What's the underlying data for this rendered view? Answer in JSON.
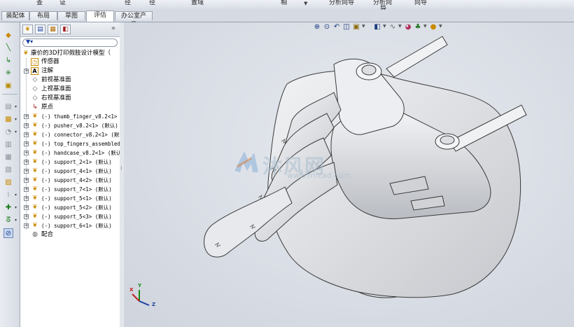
{
  "command_strip": {
    "labels": [
      "查",
      "证",
      "径",
      "径",
      "置域",
      "相",
      "分析向导",
      "分析向",
      "导",
      "向导"
    ]
  },
  "tabs": [
    {
      "label": "装配体",
      "active": false
    },
    {
      "label": "布局",
      "active": false
    },
    {
      "label": "草图",
      "active": false
    },
    {
      "label": "评估",
      "active": true
    },
    {
      "label": "办公室产品",
      "active": false
    }
  ],
  "feature_tree": {
    "filter_glyph": "▼▾",
    "more_glyph": "»",
    "root_label": "康价的3D打印假肢设计模型（",
    "items": [
      {
        "label": "传感器"
      },
      {
        "label": "注解"
      },
      {
        "label": "前视基准面"
      },
      {
        "label": "上视基准面"
      },
      {
        "label": "右视基准面"
      },
      {
        "label": "原点"
      },
      {
        "label": "(-) thumb_finger_v8.2<1>"
      },
      {
        "label": "(-) pusher_v8.2<1> (默认)"
      },
      {
        "label": "(-) connector_v8.2<1> (默认"
      },
      {
        "label": "(-) top_fingers_assembled"
      },
      {
        "label": "(-) handcase_v8.2<1> (默认"
      },
      {
        "label": "(-) support_2<1> (默认)"
      },
      {
        "label": "(-) support_4<1> (默认)"
      },
      {
        "label": "(-) support_4<2> (默认)"
      },
      {
        "label": "(-) support_7<1> (默认)"
      },
      {
        "label": "(-) support_5<1> (默认)"
      },
      {
        "label": "(-) support_5<2> (默认)"
      },
      {
        "label": "(-) support_5<3> (默认)"
      },
      {
        "label": "(-) support_6<1> (默认)"
      },
      {
        "label": "配合"
      }
    ]
  },
  "watermark": {
    "text": "沐风网",
    "url": "www.mfcad.com"
  },
  "triad": {
    "x": "X",
    "y": "Y",
    "z": "Z"
  },
  "colors": {
    "model_fill": "#e4e5e8",
    "model_stroke": "#3a3a3a",
    "accent_blue": "#1a3fa0"
  }
}
